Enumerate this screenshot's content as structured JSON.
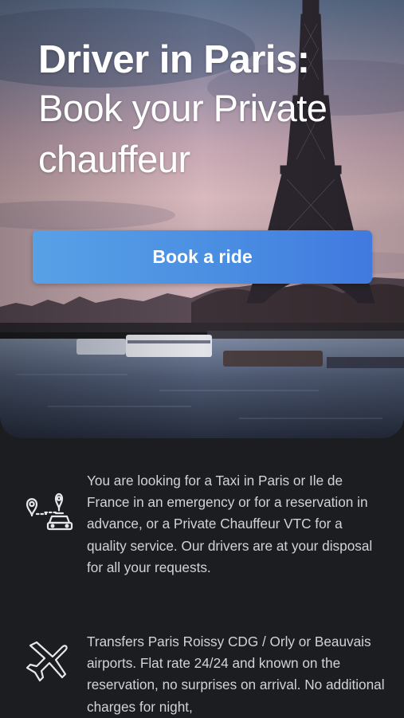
{
  "hero": {
    "title_line1": "Driver in Paris:",
    "title_line2": "Book your Private",
    "title_line3": "chauffeur",
    "cta_label": "Book a ride"
  },
  "features": [
    {
      "icon": "map-route-taxi-icon",
      "text": "You are looking for a Taxi in Paris or Ile de France in an emergency or for a reservation in advance, or a Private Chauffeur VTC for a quality service. Our drivers are at your disposal for all your requests."
    },
    {
      "icon": "airplane-icon",
      "text": "Transfers Paris Roissy CDG / Orly or Beauvais airports. Flat rate 24/24 and known on the reservation, no surprises on arrival. No additional charges for night,"
    }
  ],
  "colors": {
    "background": "#1c1d20",
    "button": "#4a8ee2",
    "text": "#d2d3d6"
  }
}
